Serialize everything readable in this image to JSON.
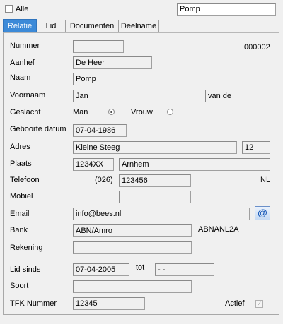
{
  "top": {
    "alle_label": "Alle",
    "search_value": "Pomp"
  },
  "tabs": [
    {
      "label": "Relatie"
    },
    {
      "label": "Lid"
    },
    {
      "label": "Documenten"
    },
    {
      "label": "Deelname"
    }
  ],
  "form": {
    "nummer": {
      "label": "Nummer",
      "value": "",
      "display": "000002"
    },
    "aanhef": {
      "label": "Aanhef",
      "value": "De Heer"
    },
    "naam": {
      "label": "Naam",
      "value": "Pomp"
    },
    "voornaam": {
      "label": "Voornaam",
      "value": "Jan",
      "tussenvoegsel": "van de"
    },
    "geslacht": {
      "label": "Geslacht",
      "man": "Man",
      "vrouw": "Vrouw",
      "selected": "Man"
    },
    "geboortedatum": {
      "label": "Geboorte datum",
      "value": "07-04-1986"
    },
    "adres": {
      "label": "Adres",
      "street": "Kleine Steeg",
      "number": "12"
    },
    "plaats": {
      "label": "Plaats",
      "postcode": "1234XX",
      "city": "Arnhem"
    },
    "telefoon": {
      "label": "Telefoon",
      "area": "(026)",
      "value": "123456",
      "country": "NL"
    },
    "mobiel": {
      "label": "Mobiel",
      "value": ""
    },
    "email": {
      "label": "Email",
      "value": "info@bees.nl",
      "button_icon": "@"
    },
    "bank": {
      "label": "Bank",
      "value": "ABN/Amro",
      "bic": "ABNANL2A"
    },
    "rekening": {
      "label": "Rekening",
      "value": ""
    },
    "lid_sinds": {
      "label": "Lid sinds",
      "value": "07-04-2005",
      "tot_label": "tot",
      "tot_value": "- -"
    },
    "soort": {
      "label": "Soort",
      "value": ""
    },
    "tfk": {
      "label": "TFK Nummer",
      "value": "12345"
    },
    "actief": {
      "label": "Actief",
      "checked": true,
      "check_glyph": "✓"
    }
  }
}
